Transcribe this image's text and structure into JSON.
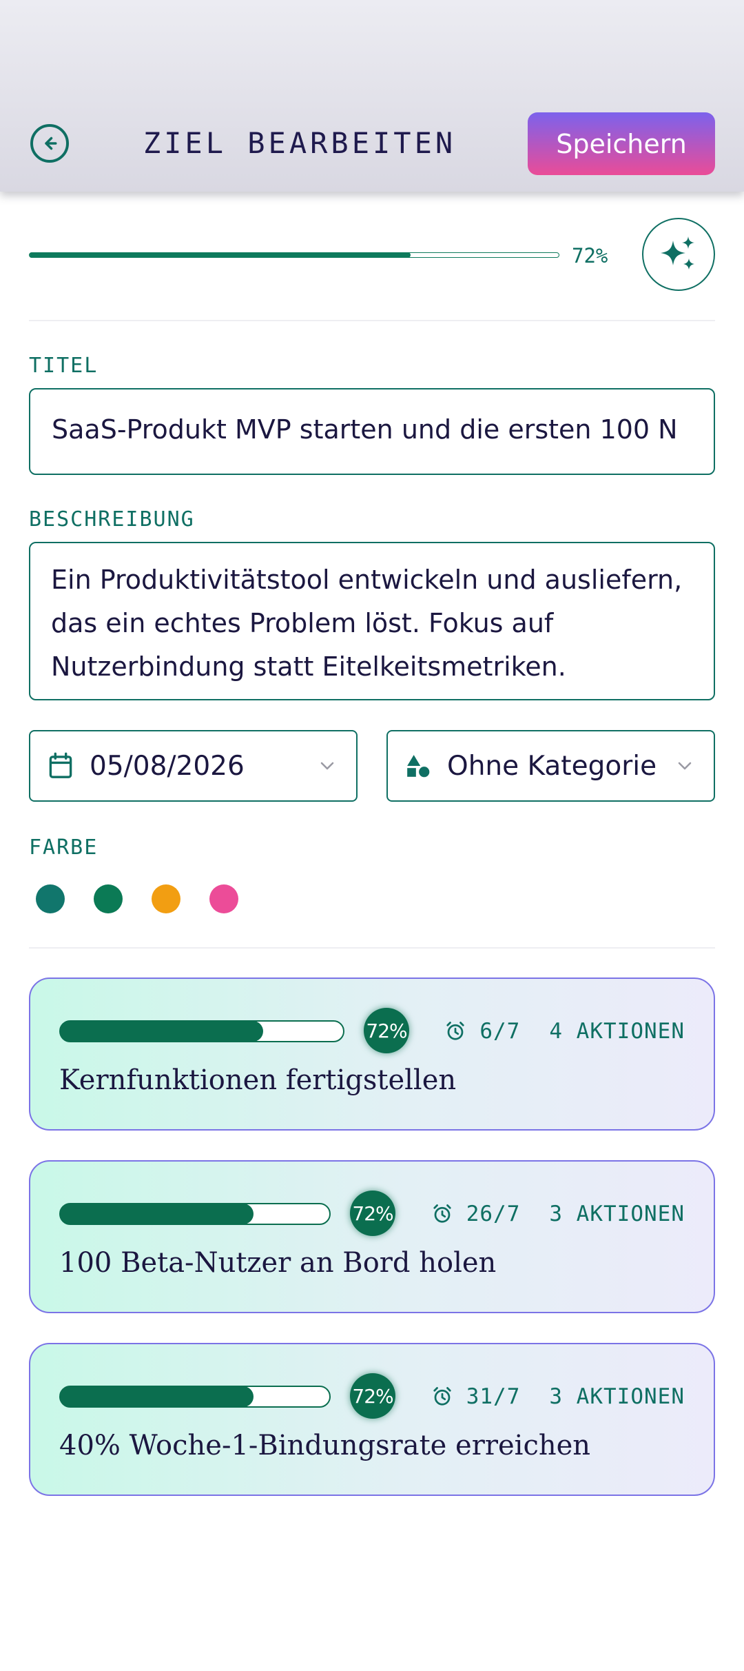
{
  "header": {
    "title": "ZIEL BEARBEITEN",
    "save_label": "Speichern",
    "back_icon": "arrow-left-circle-icon"
  },
  "progress": {
    "value": 0.72,
    "label": "72%",
    "ai_icon": "sparkles-icon"
  },
  "form": {
    "title_label": "TITEL",
    "title_value": "SaaS-Produkt MVP starten und die ersten 100 N",
    "description_label": "BESCHREIBUNG",
    "description_value": "Ein Produktivitätstool entwickeln und ausliefern, das ein echtes Problem löst. Fokus auf Nutzerbindung statt Eitelkeitsmetriken.",
    "date_value": "05/08/2026",
    "category_value": "Ohne Kategorie",
    "color_label": "FARBE",
    "colors": [
      "#11766c",
      "#0b7a55",
      "#f29e12",
      "#ec4c98"
    ]
  },
  "milestones": [
    {
      "progress": 0.72,
      "percent_label": "72%",
      "deadline": "6/7",
      "actions": "4 AKTIONEN",
      "title": "Kernfunktionen fertigstellen"
    },
    {
      "progress": 0.72,
      "percent_label": "72%",
      "deadline": "26/7",
      "actions": "3 AKTIONEN",
      "title": "100 Beta-Nutzer an Bord holen"
    },
    {
      "progress": 0.72,
      "percent_label": "72%",
      "deadline": "31/7",
      "actions": "3 AKTIONEN",
      "title": "40% Woche-1-Bindungsrate erreichen"
    }
  ],
  "theme": {
    "accent": "#0f6f63",
    "progress_green": "#0b6e4f",
    "text_dark": "#1b1740",
    "save_gradient_top": "#7c62ec",
    "save_gradient_bottom": "#ea4c97"
  }
}
